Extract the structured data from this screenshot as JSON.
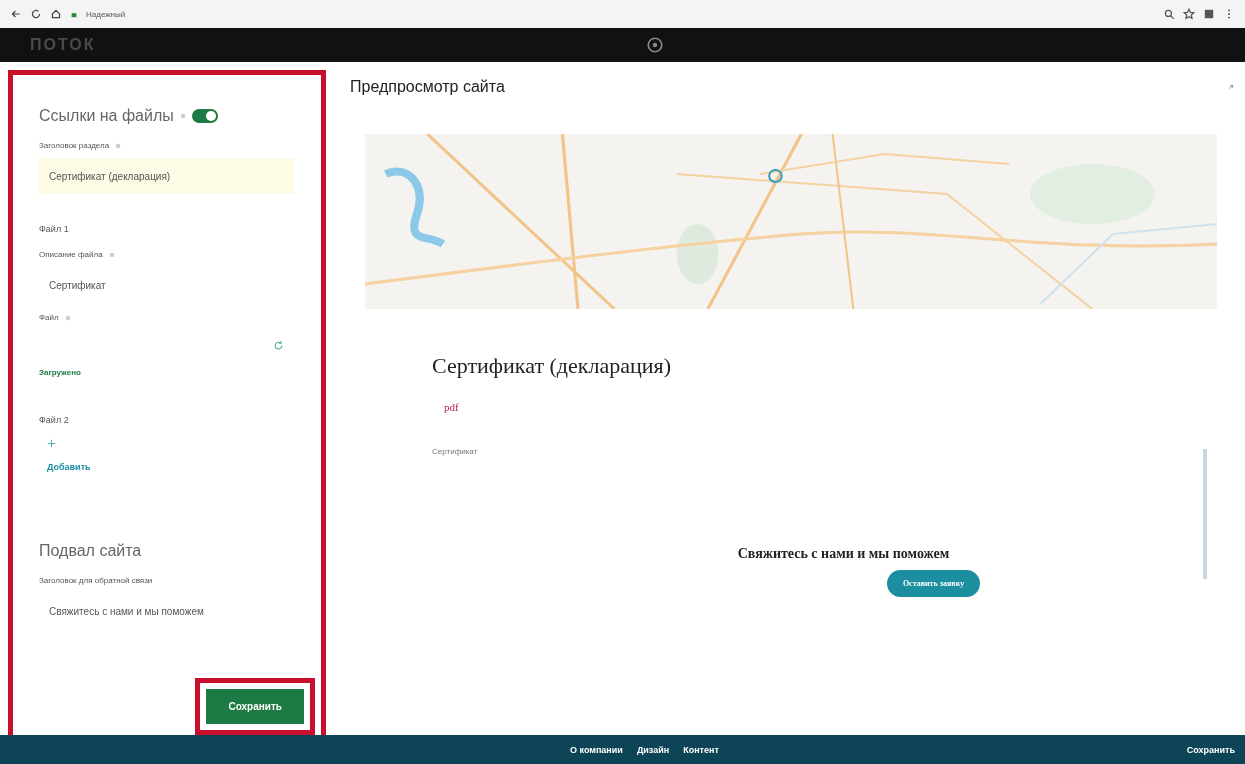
{
  "browser": {
    "security_label": "Надежный"
  },
  "header": {
    "logo": "ПОТОК"
  },
  "editor": {
    "items": [
      {
        "kind": "section",
        "text": "Ссылки на файлы",
        "info": true,
        "toggle_on": true
      },
      {
        "kind": "label",
        "text": "Заголовок раздела",
        "info": true
      },
      {
        "kind": "field",
        "value": "Сертификат (декларация)",
        "highlighted": true
      },
      {
        "kind": "group",
        "text": "Файл 1"
      },
      {
        "kind": "label",
        "text": "Описание файла",
        "info": true
      },
      {
        "kind": "field",
        "value": "Сертификат",
        "highlighted": false
      },
      {
        "kind": "label",
        "text": "Файл",
        "info": true
      },
      {
        "kind": "file_field"
      },
      {
        "kind": "status",
        "text": "Загружено"
      },
      {
        "kind": "group",
        "text": "Файл 2"
      },
      {
        "kind": "add",
        "text": "Добавить"
      },
      {
        "kind": "section",
        "text": "Подвал сайта",
        "info": false
      },
      {
        "kind": "label",
        "text": "Заголовок для обратной связи",
        "info": false
      },
      {
        "kind": "field",
        "value": "Свяжитесь с нами и мы поможем",
        "highlighted": false
      }
    ],
    "save_button": "Сохранить"
  },
  "preview": {
    "title": "Предпросмотр сайта",
    "section_title": "Сертификат (декларация)",
    "file": {
      "type": "pdf",
      "caption": "Сертификат"
    },
    "cta": {
      "text": "Свяжитесь с нами и мы поможем",
      "button": "Оставить заявку"
    }
  },
  "footer": {
    "nav": [
      "О компании",
      "Дизайн",
      "Контент"
    ],
    "save": "Сохранить"
  }
}
